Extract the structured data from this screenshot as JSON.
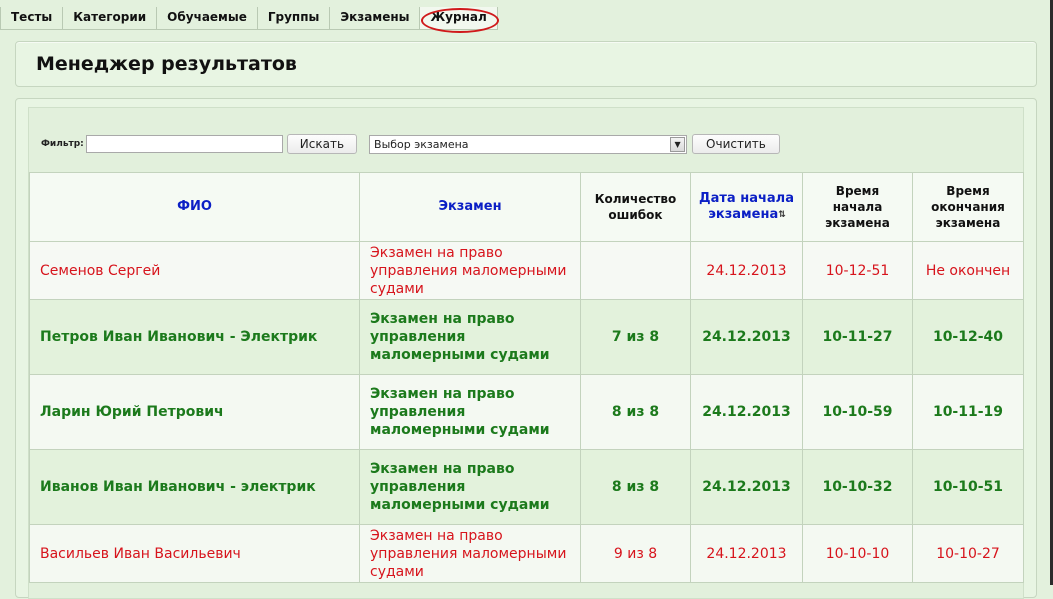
{
  "nav": {
    "tabs": [
      "Тесты",
      "Категории",
      "Обучаемые",
      "Группы",
      "Экзамены",
      "Журнал"
    ],
    "active": "Журнал"
  },
  "page_title": "Менеджер результатов",
  "filter": {
    "label": "Фильтр:",
    "value": "",
    "search_button": "Искать",
    "select_value": "Выбор экзамена",
    "clear_button": "Очистить"
  },
  "table": {
    "headers": {
      "name": "ФИО",
      "exam": "Экзамен",
      "errors": "Количество ошибок",
      "start_date": "Дата начала экзамена",
      "start_time": "Время начала экзамена",
      "end_time": "Время окончания экзамена"
    },
    "rows": [
      {
        "name": "Семенов Сергей",
        "exam": "Экзамен на право управления маломерными судами",
        "errors": "",
        "start_date": "24.12.2013",
        "start_time": "10-12-51",
        "end_time": "Не окончен"
      },
      {
        "name": "Петров Иван Иванович - Электрик",
        "exam": "Экзамен на право управления маломерными судами",
        "errors": "7 из 8",
        "start_date": "24.12.2013",
        "start_time": "10-11-27",
        "end_time": "10-12-40"
      },
      {
        "name": "Ларин Юрий Петрович",
        "exam": "Экзамен на право управления маломерными судами",
        "errors": "8 из 8",
        "start_date": "24.12.2013",
        "start_time": "10-10-59",
        "end_time": "10-11-19"
      },
      {
        "name": "Иванов Иван Иванович - электрик",
        "exam": "Экзамен на право управления маломерными судами",
        "errors": "8 из 8",
        "start_date": "24.12.2013",
        "start_time": "10-10-32",
        "end_time": "10-10-51"
      },
      {
        "name": "Васильев Иван Васильевич",
        "exam": "Экзамен на право управления маломерными судами",
        "errors": "9 из 8",
        "start_date": "24.12.2013",
        "start_time": "10-10-10",
        "end_time": "10-10-27"
      }
    ]
  },
  "colors": {
    "pending_text": "#d7141c",
    "done_text": "#1c7a1c",
    "link_header": "#0b1fc5",
    "active_tab_marker": "#d0191b"
  }
}
